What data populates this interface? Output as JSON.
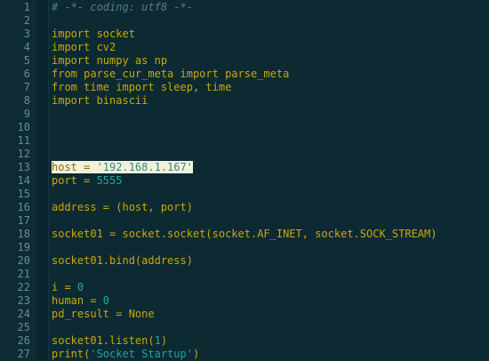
{
  "editor": {
    "lines": [
      {
        "n": "1",
        "parts": [
          {
            "t": "# -*- coding: utf8 -*-",
            "c": "comment"
          }
        ]
      },
      {
        "n": "2",
        "parts": []
      },
      {
        "n": "3",
        "parts": [
          {
            "t": "import socket",
            "c": "kw"
          }
        ]
      },
      {
        "n": "4",
        "parts": [
          {
            "t": "import cv2",
            "c": "kw"
          }
        ]
      },
      {
        "n": "5",
        "parts": [
          {
            "t": "import numpy as np",
            "c": "kw"
          }
        ]
      },
      {
        "n": "6",
        "parts": [
          {
            "t": "from parse_cur_meta import parse_meta",
            "c": "kw"
          }
        ]
      },
      {
        "n": "7",
        "parts": [
          {
            "t": "from time import sleep, time",
            "c": "kw"
          }
        ]
      },
      {
        "n": "8",
        "parts": [
          {
            "t": "import binascii",
            "c": "kw"
          }
        ]
      },
      {
        "n": "9",
        "parts": []
      },
      {
        "n": "10",
        "parts": []
      },
      {
        "n": "11",
        "parts": []
      },
      {
        "n": "12",
        "parts": []
      },
      {
        "n": "13",
        "parts": [
          {
            "t": "host = ",
            "c": "kw"
          },
          {
            "t": "'192.168.1.167'",
            "c": "str"
          }
        ],
        "selected": true
      },
      {
        "n": "14",
        "parts": [
          {
            "t": "port = ",
            "c": "kw"
          },
          {
            "t": "5555",
            "c": "num"
          }
        ]
      },
      {
        "n": "15",
        "parts": []
      },
      {
        "n": "16",
        "parts": [
          {
            "t": "address = (host, port)",
            "c": "kw"
          }
        ]
      },
      {
        "n": "17",
        "parts": []
      },
      {
        "n": "18",
        "parts": [
          {
            "t": "socket01 = socket.socket(socket.AF_INET, socket.SOCK_STREAM)",
            "c": "kw"
          }
        ]
      },
      {
        "n": "19",
        "parts": []
      },
      {
        "n": "20",
        "parts": [
          {
            "t": "socket01.bind(address)",
            "c": "kw"
          }
        ]
      },
      {
        "n": "21",
        "parts": []
      },
      {
        "n": "22",
        "parts": [
          {
            "t": "i = ",
            "c": "kw"
          },
          {
            "t": "0",
            "c": "num"
          }
        ]
      },
      {
        "n": "23",
        "parts": [
          {
            "t": "human = ",
            "c": "kw"
          },
          {
            "t": "0",
            "c": "num"
          }
        ]
      },
      {
        "n": "24",
        "parts": [
          {
            "t": "pd_result = None",
            "c": "kw"
          }
        ]
      },
      {
        "n": "25",
        "parts": []
      },
      {
        "n": "26",
        "parts": [
          {
            "t": "socket01.listen(",
            "c": "kw"
          },
          {
            "t": "1",
            "c": "num"
          },
          {
            "t": ")",
            "c": "kw"
          }
        ]
      },
      {
        "n": "27",
        "parts": [
          {
            "t": "print(",
            "c": "kw"
          },
          {
            "t": "'Socket Startup'",
            "c": "str"
          },
          {
            "t": ")",
            "c": "kw"
          }
        ]
      }
    ]
  },
  "colors": {
    "background": "#0d2a33",
    "keyword": "#c9a80a",
    "string": "#22a59b",
    "comment": "#5b7a82",
    "gutter_text": "#6b8b93",
    "selection": "#f3f1dc"
  }
}
